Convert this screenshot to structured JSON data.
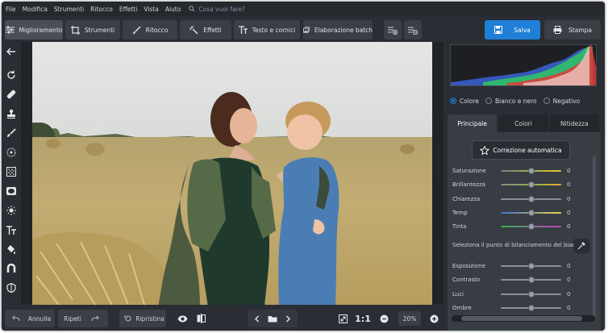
{
  "menu": [
    "File",
    "Modifica",
    "Strumenti",
    "Ritocco",
    "Effetti",
    "Vista",
    "Aiuto"
  ],
  "search": {
    "placeholder": "Cosa vuoi fare?",
    "icon": "search-icon"
  },
  "toolbar": {
    "miglioramento": "Miglioramento",
    "strumenti": "Strumenti",
    "ritocco": "Ritocco",
    "effetti": "Effetti",
    "testo": "Testo e cornici",
    "batch": "Elaborazione batch",
    "save": "Salva",
    "print": "Stampa"
  },
  "colors": {
    "accent": "#1f7fd6",
    "bg": "#2a2d33",
    "panel": "#383c43"
  },
  "modes": {
    "color": "Colore",
    "bw": "Bianco e nero",
    "neg": "Negativo",
    "selected": "Colore"
  },
  "tabs": {
    "principale": "Principale",
    "colori": "Colori",
    "nitidezza": "Nitidezza",
    "active": "Principale"
  },
  "auto": "Correzione automatica",
  "sliders": [
    {
      "label": "Saturazione",
      "value": "0"
    },
    {
      "label": "Brillantezza",
      "value": "0"
    },
    {
      "label": "Chiarezza",
      "value": "0"
    },
    {
      "label": "Temp",
      "value": "0"
    },
    {
      "label": "Tinta",
      "value": "0"
    }
  ],
  "wb": "Seleziona il punto di bilanciamento del bianco",
  "sliders2": [
    {
      "label": "Esposizione",
      "value": "0"
    },
    {
      "label": "Contrasto",
      "value": "0"
    },
    {
      "label": "Luci",
      "value": "0"
    },
    {
      "label": "Ombre",
      "value": "0"
    }
  ],
  "bottom": {
    "undo": "Annulla",
    "redo": "Ripeti",
    "restore": "Ripristina",
    "ratio": "1:1",
    "zoom": "20%"
  }
}
